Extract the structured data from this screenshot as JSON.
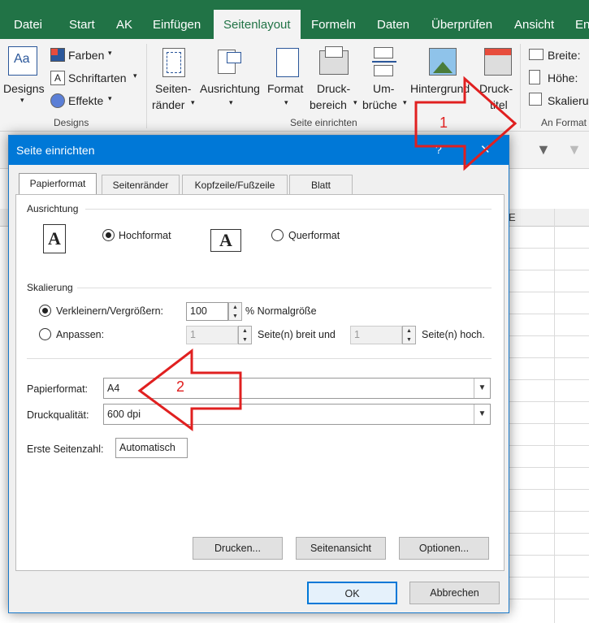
{
  "ribbon_tabs": [
    "Datei",
    "Start",
    "AK",
    "Einfügen",
    "Seitenlayout",
    "Formeln",
    "Daten",
    "Überprüfen",
    "Ansicht",
    "Ent"
  ],
  "active_tab": "Seitenlayout",
  "ribbon": {
    "designs": "Designs",
    "farben": "Farben",
    "schriftarten": "Schriftarten",
    "effekte": "Effekte",
    "group_designs": "Designs",
    "seitenraender_1": "Seiten-",
    "seitenraender_2": "ränder",
    "ausrichtung": "Ausrichtung",
    "format": "Format",
    "druckbereich_1": "Druck-",
    "druckbereich_2": "bereich",
    "umbrueche_1": "Um-",
    "umbrueche_2": "brüche",
    "hintergrund": "Hintergrund",
    "drucktitel_1": "Druck-",
    "drucktitel_2": "titel",
    "group_seite": "Seite einrichten",
    "breite": "Breite:",
    "hoehe": "Höhe:",
    "skalierung": "Skalieru",
    "group_anformat": "An Format"
  },
  "sheet": {
    "col_e": "E"
  },
  "dialog": {
    "title": "Seite einrichten",
    "help": "?",
    "close": "✕",
    "tabs": [
      "Papierformat",
      "Seitenränder",
      "Kopfzeile/Fußzeile",
      "Blatt"
    ],
    "selected_tab": "Papierformat",
    "ausrichtung": {
      "heading": "Ausrichtung",
      "icon_letter": "A",
      "hochformat": "Hochformat",
      "querformat": "Querformat",
      "selected": "Hochformat"
    },
    "skalierung": {
      "heading": "Skalierung",
      "verkleinern": "Verkleinern/Vergrößern:",
      "verkleinern_value": "100",
      "normalgroesse": "% Normalgröße",
      "anpassen": "Anpassen:",
      "breit_value": "1",
      "breit_label": "Seite(n) breit und",
      "hoch_value": "1",
      "hoch_label": "Seite(n) hoch."
    },
    "papierformat_label": "Papierformat:",
    "papierformat_value": "A4",
    "druckqualitaet_label": "Druckqualität:",
    "druckqualitaet_value": "600 dpi",
    "erste_seitenzahl_label": "Erste Seitenzahl:",
    "erste_seitenzahl_value": "Automatisch",
    "buttons": {
      "drucken": "Drucken...",
      "seitenansicht": "Seitenansicht",
      "optionen": "Optionen...",
      "ok": "OK",
      "abbrechen": "Abbrechen"
    }
  },
  "callouts": [
    "1",
    "2"
  ],
  "colors": {
    "excel_green": "#217346",
    "title_blue": "#0078d7",
    "arrow_red": "#e02020"
  }
}
